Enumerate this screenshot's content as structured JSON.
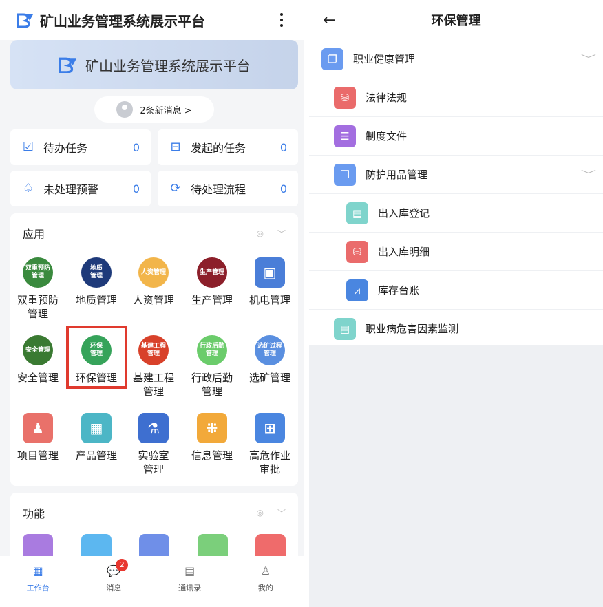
{
  "left": {
    "app_title": "矿山业务管理系统展示平台",
    "banner_title": "矿山业务管理系统展示平台",
    "new_messages": "2条新消息 >",
    "stats": [
      {
        "label": "待办任务",
        "count": "0",
        "icon": "calendar-check-icon"
      },
      {
        "label": "发起的任务",
        "count": "0",
        "icon": "briefcase-icon"
      },
      {
        "label": "未处理预警",
        "count": "0",
        "icon": "bell-icon"
      },
      {
        "label": "待处理流程",
        "count": "0",
        "icon": "flow-icon"
      }
    ],
    "apps_section": {
      "title": "应用"
    },
    "apps": [
      {
        "label": "双重预防\n管理",
        "icon_text": "双重预防\n管理",
        "color": "#3a8a3e"
      },
      {
        "label": "地质管理",
        "icon_text": "地质\n管理",
        "color": "#1e3a7a"
      },
      {
        "label": "人资管理",
        "icon_text": "人资管理",
        "color": "#f2b54a"
      },
      {
        "label": "生产管理",
        "icon_text": "生产管理",
        "color": "#8c1f2a"
      },
      {
        "label": "机电管理",
        "icon_text": "▣",
        "color": "#4a7ed8"
      },
      {
        "label": "安全管理",
        "icon_text": "安全管理",
        "color": "#3a7a32"
      },
      {
        "label": "环保管理",
        "icon_text": "环保\n管理",
        "color": "#36a35a"
      },
      {
        "label": "基建工程\n管理",
        "icon_text": "基建工程\n管理",
        "color": "#d8412a"
      },
      {
        "label": "行政后勤\n管理",
        "icon_text": "行政后勤\n管理",
        "color": "#6bcc6b"
      },
      {
        "label": "选矿管理",
        "icon_text": "选矿过程\n管理",
        "color": "#5a8fe0"
      },
      {
        "label": "项目管理",
        "icon_text": "♟",
        "color": "#e9716a"
      },
      {
        "label": "产品管理",
        "icon_text": "▦",
        "color": "#4cb6c6"
      },
      {
        "label": "实验室\n管理",
        "icon_text": "⚗",
        "color": "#3e6fd0"
      },
      {
        "label": "信息管理",
        "icon_text": "⁜",
        "color": "#f2a93a"
      },
      {
        "label": "高危作业\n审批",
        "icon_text": "⊞",
        "color": "#4a86e0"
      }
    ],
    "functions_section": {
      "title": "功能"
    },
    "function_icon_colors": [
      "#a97be0",
      "#5cb7f0",
      "#6f8fe8",
      "#7bcf7b",
      "#ef6b6b"
    ],
    "tabs": [
      {
        "label": "工作台",
        "icon": "grid-icon"
      },
      {
        "label": "消息",
        "icon": "chat-icon",
        "badge": "2"
      },
      {
        "label": "通讯录",
        "icon": "contacts-icon"
      },
      {
        "label": "我的",
        "icon": "user-icon"
      }
    ]
  },
  "right": {
    "title": "环保管理",
    "rows": [
      {
        "label": "职业健康管理",
        "color": "#6a9bf0",
        "icon": "folder-icon",
        "expand": true
      },
      {
        "label": "法律法规",
        "color": "#ea6b6b",
        "icon": "database-icon",
        "expand": false
      },
      {
        "label": "制度文件",
        "color": "#a36ee0",
        "icon": "list-icon",
        "expand": false
      },
      {
        "label": "防护用品管理",
        "color": "#6a9bf0",
        "icon": "folder-icon",
        "expand": true
      },
      {
        "label": "出入库登记",
        "color": "#7fd4cc",
        "icon": "clipboard-icon",
        "expand": false
      },
      {
        "label": "出入库明细",
        "color": "#ea6b6b",
        "icon": "database-icon",
        "expand": false
      },
      {
        "label": "库存台账",
        "color": "#4a86e0",
        "icon": "chart-icon",
        "expand": false
      },
      {
        "label": "职业病危害因素监测",
        "color": "#7fd4cc",
        "icon": "clipboard-icon",
        "expand": false
      }
    ]
  }
}
